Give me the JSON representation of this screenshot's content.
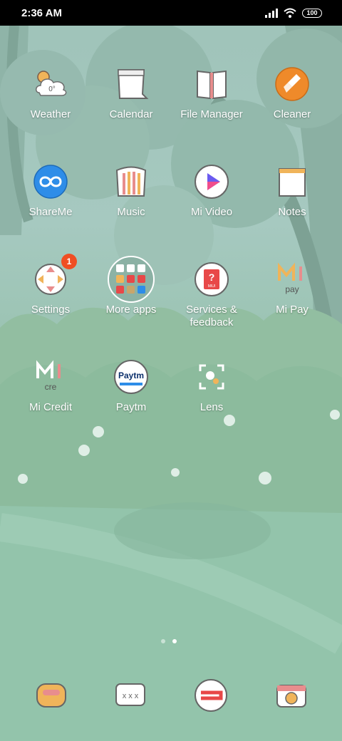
{
  "status_bar": {
    "time": "2:36 AM",
    "battery": "100"
  },
  "apps": [
    {
      "label": "Weather",
      "icon": "weather-icon",
      "weather_temp": "0°"
    },
    {
      "label": "Calendar",
      "icon": "calendar-icon"
    },
    {
      "label": "File Manager",
      "icon": "file-manager-icon"
    },
    {
      "label": "Cleaner",
      "icon": "cleaner-icon"
    },
    {
      "label": "ShareMe",
      "icon": "shareme-icon"
    },
    {
      "label": "Music",
      "icon": "music-icon"
    },
    {
      "label": "Mi Video",
      "icon": "mi-video-icon"
    },
    {
      "label": "Notes",
      "icon": "notes-icon"
    },
    {
      "label": "Settings",
      "icon": "settings-icon",
      "badge": "1"
    },
    {
      "label": "More apps",
      "icon": "folder-icon"
    },
    {
      "label": "Services & feedback",
      "icon": "services-feedback-icon",
      "icon_text": "MIUI"
    },
    {
      "label": "Mi Pay",
      "icon": "mi-pay-icon",
      "icon_text": "pay"
    },
    {
      "label": "Mi Credit",
      "icon": "mi-credit-icon",
      "icon_text": "cre"
    },
    {
      "label": "Paytm",
      "icon": "paytm-icon",
      "icon_text": "Paytm"
    },
    {
      "label": "Lens",
      "icon": "lens-icon"
    }
  ],
  "page_indicator": {
    "pages": 2,
    "current": 2
  },
  "dock": [
    {
      "icon": "phone-icon"
    },
    {
      "icon": "messages-icon"
    },
    {
      "icon": "browser-icon"
    },
    {
      "icon": "camera-icon"
    }
  ],
  "colors": {
    "accent_badge": "#f04e23",
    "cleaner_orange": "#ef8a2a",
    "shareme_blue": "#2e8de8"
  }
}
